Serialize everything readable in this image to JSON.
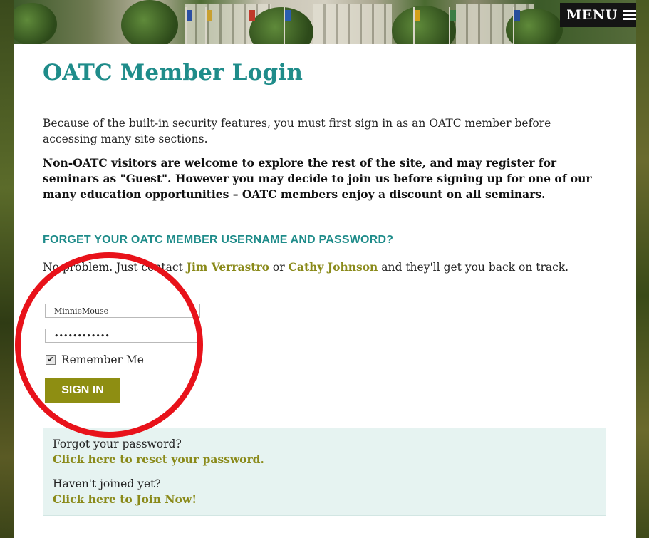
{
  "header": {
    "menu_label": "MENU"
  },
  "page": {
    "title": "OATC Member Login",
    "intro": "Because of the built-in security features, you must first sign in as an OATC member before accessing many site sections.",
    "notice": "Non-OATC visitors are welcome to explore the rest of the site, and may register for seminars as \"Guest\". However you may decide to join us before signing up for one of our many education opportunities – OATC members enjoy a discount on all seminars.",
    "forgot_heading": "FORGET YOUR OATC MEMBER USERNAME AND PASSWORD?",
    "contact_prefix": "No problem. Just contact ",
    "contact_name1": "Jim Verrastro",
    "contact_mid": " or ",
    "contact_name2": "Cathy Johnson",
    "contact_suffix": " and they'll get you back on track."
  },
  "login": {
    "username_value": "MinnieMouse",
    "password_value": "••••••••••••",
    "remember_label": "Remember Me",
    "remember_checked": true,
    "signin_label": "SIGN IN"
  },
  "help": {
    "forgot_question": "Forgot your password?",
    "reset_link": "Click here to reset your password.",
    "join_question": "Haven't joined yet?",
    "join_link": "Click here to Join Now!"
  },
  "colors": {
    "accent_teal": "#1f8c8a",
    "link_olive": "#8a8a1a",
    "button_olive": "#8e8e12",
    "help_bg": "#e6f3f1",
    "annotation_red": "#e8121a"
  }
}
